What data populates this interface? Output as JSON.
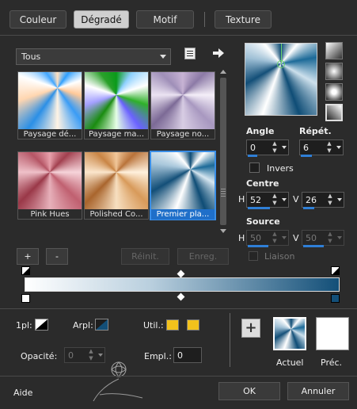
{
  "tabs": [
    {
      "label": "Couleur"
    },
    {
      "label": "Dégradé"
    },
    {
      "label": "Motif"
    },
    {
      "label": "Texture"
    }
  ],
  "category": {
    "selected": "Tous"
  },
  "thumbnails": [
    {
      "caption": "Paysage dé..."
    },
    {
      "caption": "Paysage ma..."
    },
    {
      "caption": "Paysage no..."
    },
    {
      "caption": "Pink Hues"
    },
    {
      "caption": "Polished Co..."
    },
    {
      "caption": "Premier pla..."
    }
  ],
  "angle": {
    "label": "Angle",
    "value": "0"
  },
  "repeat": {
    "label": "Répét.",
    "value": "6"
  },
  "invert": {
    "label": "Invers",
    "checked": false
  },
  "centre": {
    "label": "Centre",
    "h_label": "H",
    "h_value": "52",
    "v_label": "V",
    "v_value": "26"
  },
  "source": {
    "label": "Source",
    "h_label": "H",
    "h_value": "50",
    "v_label": "V",
    "v_value": "50"
  },
  "link": {
    "label": "Liaison",
    "checked": false
  },
  "buttons": {
    "add": "+",
    "remove": "-",
    "reset": "Réinit.",
    "save": "Enreg.",
    "ok": "OK",
    "cancel": "Annuler",
    "help": "Aide"
  },
  "bottom": {
    "style_label": "1pl:",
    "arpl_label": "Arpl:",
    "util_label": "Util.:",
    "opacity_label": "Opacité:",
    "opacity_value": "0",
    "empl_label": "Empl.:",
    "empl_value": "0",
    "current_label": "Actuel",
    "previous_label": "Préc."
  },
  "colors": {
    "accent": "#2f7fd6",
    "gradient_start": "#ffffff",
    "gradient_end": "#134f78",
    "swatch_yellow": "#f2c21c"
  },
  "icons": [
    "menu-icon",
    "arrow-right-icon",
    "plus-icon",
    "stop-marker-icon",
    "midpoint-diamond-icon"
  ]
}
